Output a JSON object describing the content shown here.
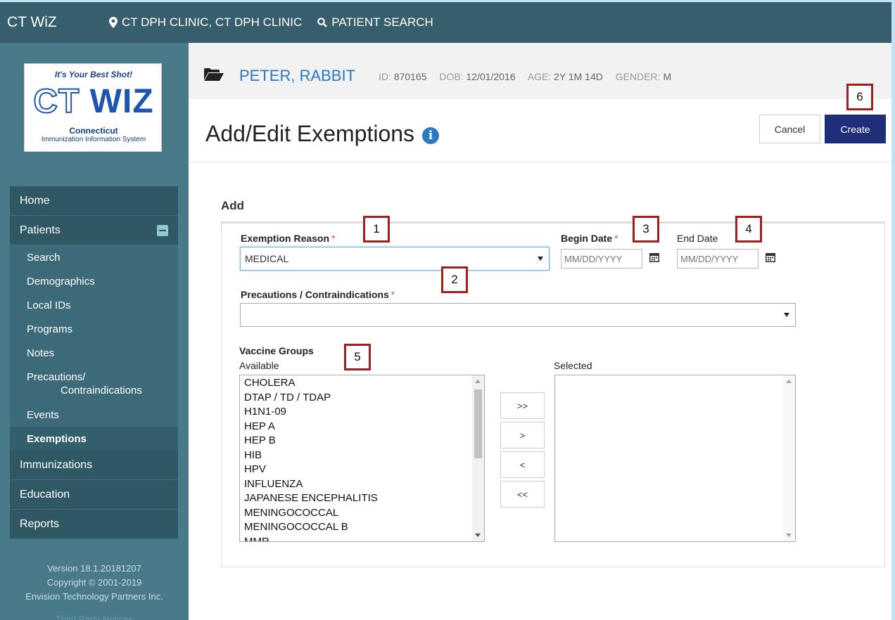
{
  "app": {
    "brand": "CT WiZ",
    "clinic": "CT DPH CLINIC, CT DPH CLINIC",
    "patient_search": "PATIENT SEARCH"
  },
  "logo": {
    "tagline": "It's Your Best Shot!",
    "ct": "CT",
    "wiz": "WIZ",
    "state": "Connecticut",
    "system": "Immunization Information System"
  },
  "sidebar": {
    "home": "Home",
    "patients": "Patients",
    "patient_items": [
      "Search",
      "Demographics",
      "Local IDs",
      "Programs",
      "Notes",
      "Precautions/",
      "Contraindications",
      "Events",
      "Exemptions"
    ],
    "immunizations": "Immunizations",
    "education": "Education",
    "reports": "Reports",
    "version": "Version 18.1.20181207",
    "copyright": "Copyright © 2001-2019",
    "company": "Envision Technology Partners Inc.",
    "faded_link": "Third Party Notices"
  },
  "patient": {
    "name": "PETER, RABBIT",
    "id_label": "ID:",
    "id": "870165",
    "dob_label": "DOB:",
    "dob": "12/01/2016",
    "age_label": "AGE:",
    "age": "2Y 1M 14D",
    "gender_label": "GENDER:",
    "gender": "M"
  },
  "page": {
    "title": "Add/Edit Exemptions",
    "info": "i",
    "cancel": "Cancel",
    "create": "Create",
    "section": "Add"
  },
  "form": {
    "exemption_reason_label": "Exemption Reason",
    "exemption_reason_value": "MEDICAL",
    "required": "*",
    "begin_date_label": "Begin Date",
    "begin_date_placeholder": "MM/DD/YYYY",
    "end_date_label": "End Date",
    "end_date_placeholder": "MM/DD/YYYY",
    "precautions_label": "Precautions / Contraindications",
    "precautions_value": "",
    "vaccine_groups_label": "Vaccine Groups",
    "available_label": "Available",
    "selected_label": "Selected",
    "available_items": [
      "CHOLERA",
      "DTAP / TD / TDAP",
      "H1N1-09",
      "HEP A",
      "HEP B",
      "HIB",
      "HPV",
      "INFLUENZA",
      "JAPANESE ENCEPHALITIS",
      "MENINGOCOCCAL",
      "MENINGOCOCCAL B",
      "MMR"
    ],
    "selected_items": [],
    "move_all_right": ">>",
    "move_right": ">",
    "move_left": "<",
    "move_all_left": "<<"
  },
  "callouts": [
    "1",
    "2",
    "3",
    "4",
    "5",
    "6"
  ],
  "colors": {
    "topbar": "#365e6c",
    "sidebar": "#497a8a",
    "nav_item": "#2f5764",
    "patient_name": "#2a79c4",
    "create_button": "#1e2e78",
    "callout_border": "#a31f1f"
  }
}
